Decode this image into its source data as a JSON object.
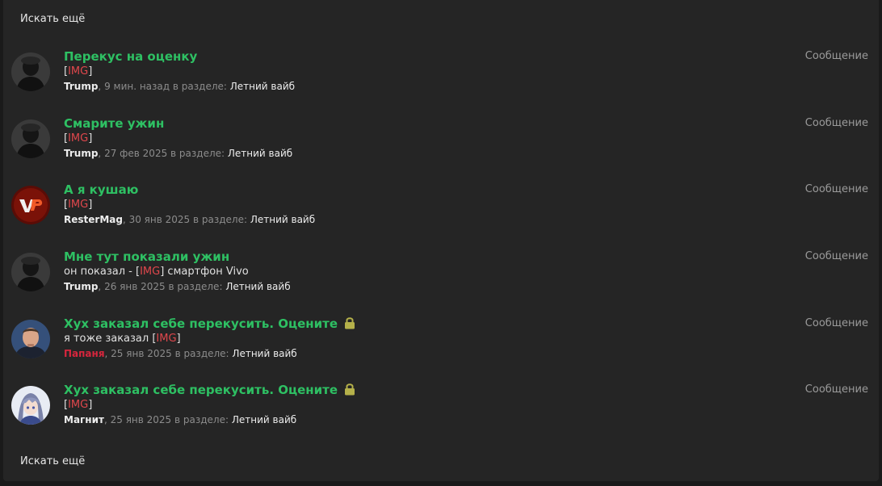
{
  "search": {
    "more_label_top": "Искать ещё",
    "more_label_bottom": "Искать ещё"
  },
  "common": {
    "img_word": "IMG",
    "in_section": "в разделе:"
  },
  "results": [
    {
      "title": "Перекус на оценку",
      "locked": false,
      "snippet_before": "",
      "snippet_after": "",
      "author": "Trump",
      "time": "9 мин. назад",
      "forum": "Летний вайб",
      "type": "Сообщение",
      "avatar": "dark-portrait"
    },
    {
      "title": "Смарите ужин",
      "locked": false,
      "snippet_before": "",
      "snippet_after": "",
      "author": "Trump",
      "time": "27 фев 2025",
      "forum": "Летний вайб",
      "type": "Сообщение",
      "avatar": "dark-portrait"
    },
    {
      "title": "А я кушаю",
      "locked": false,
      "snippet_before": "",
      "snippet_after": "",
      "author": "ResterMag",
      "time": "30 янв 2025",
      "forum": "Летний вайб",
      "type": "Сообщение",
      "avatar": "vp-logo"
    },
    {
      "title": "Мне тут показали ужин",
      "locked": false,
      "snippet_before": "он показал - ",
      "snippet_after": " смартфон Vivo",
      "author": "Trump",
      "time": "26 янв 2025",
      "forum": "Летний вайб",
      "type": "Сообщение",
      "avatar": "dark-portrait"
    },
    {
      "title": "Хух заказал себе перекусить. Оцените",
      "locked": true,
      "snippet_before": "я тоже заказал ",
      "snippet_after": "",
      "author": "Папаня",
      "author_banned": true,
      "time": "25 янв 2025",
      "forum": "Летний вайб",
      "type": "Сообщение",
      "avatar": "man-portrait"
    },
    {
      "title": "Хух заказал себе перекусить. Оцените",
      "locked": true,
      "snippet_before": "",
      "snippet_after": "",
      "author": "Магнит",
      "time": "25 янв 2025",
      "forum": "Летний вайб",
      "type": "Сообщение",
      "avatar": "anime-portrait"
    }
  ],
  "colors": {
    "title": "#2ec063",
    "img_word": "#e0474c",
    "banned_author": "#d7263d",
    "lock": "#b5b14a",
    "panel_bg": "#252525"
  }
}
